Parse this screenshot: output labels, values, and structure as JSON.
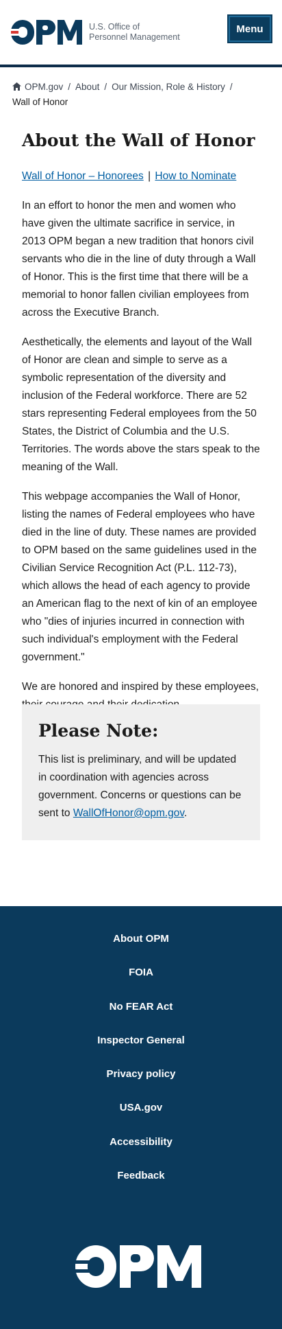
{
  "header": {
    "logo_line1": "U.S. Office of",
    "logo_line2": "Personnel Management",
    "menu_label": "Menu",
    "icons": {
      "logo": "opm-logo"
    }
  },
  "breadcrumb": {
    "items": [
      "OPM.gov",
      "About",
      "Our Mission, Role & History"
    ],
    "separator": "/",
    "current": "Wall of Honor",
    "home_icon": "home-icon"
  },
  "main": {
    "title": "About the Wall of Honor",
    "link_honorees": "Wall of Honor – Honorees",
    "link_separator": "|",
    "link_nominate": "How to Nominate",
    "paragraphs": [
      "In an effort to honor the men and women who have given the ultimate sacrifice in service, in 2013 OPM began a new tradition that honors civil servants who die in the line of duty through a Wall of Honor. This is the first time that there will be a memorial to honor fallen civilian employees from across the Executive Branch.",
      "Aesthetically, the elements and layout of the Wall of Honor are clean and simple to serve as a symbolic representation of the diversity and inclusion of the Federal workforce. There are 52 stars representing Federal employees from the 50 States, the District of Columbia and the U.S. Territories. The words above the stars speak to the meaning of the Wall.",
      "This webpage accompanies the Wall of Honor, listing the names of Federal employees who have died in the line of duty. These names are provided to OPM based on the same guidelines used in the Civilian Service Recognition Act (P.L. 112-73), which allows the head of each agency to provide an American flag to the next of kin of an employee who \"dies of injuries incurred in connection with such individual's employment with the Federal government.\"",
      "We are honored and inspired by these employees, their courage and their dedication."
    ]
  },
  "note": {
    "title": "Please Note:",
    "text": "This list is preliminary, and will be updated in coordination with agencies across government. Concerns or questions can be sent to ",
    "email": "WallOfHonor@opm.gov",
    "trailing": "."
  },
  "footer": {
    "links": [
      "About OPM",
      "FOIA",
      "No FEAR Act",
      "Inspector General",
      "Privacy policy",
      "USA.gov",
      "Accessibility",
      "Feedback"
    ],
    "logo_icon": "opm-footer-logo"
  },
  "colors": {
    "brand_navy": "#0b3a5c",
    "link_blue": "#005ea2",
    "brand_red": "#d83933",
    "note_bg": "#efefef"
  }
}
